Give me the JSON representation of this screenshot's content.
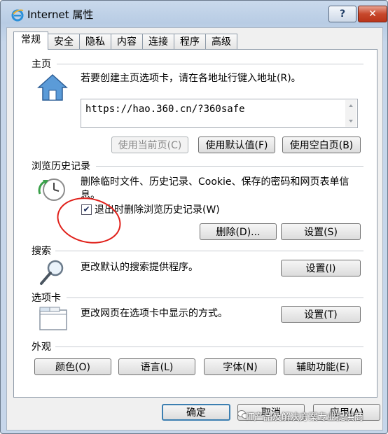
{
  "window": {
    "title": "Internet 属性",
    "help": "?",
    "close": "✕"
  },
  "tabs": [
    {
      "label": "常规"
    },
    {
      "label": "安全"
    },
    {
      "label": "隐私"
    },
    {
      "label": "内容"
    },
    {
      "label": "连接"
    },
    {
      "label": "程序"
    },
    {
      "label": "高级"
    }
  ],
  "homepage": {
    "title": "主页",
    "desc": "若要创建主页选项卡，请在各地址行键入地址(R)。",
    "url": "https://hao.360.cn/?360safe",
    "btn_current": "使用当前页(C)",
    "btn_default": "使用默认值(F)",
    "btn_blank": "使用空白页(B)"
  },
  "history": {
    "title": "浏览历史记录",
    "desc": "删除临时文件、历史记录、Cookie、保存的密码和网页表单信息。",
    "checkbox_label": "退出时删除浏览历史记录(W)",
    "checkbox_checked": true,
    "btn_delete": "删除(D)...",
    "btn_settings": "设置(S)"
  },
  "search": {
    "title": "搜索",
    "desc": "更改默认的搜索提供程序。",
    "btn_settings": "设置(I)"
  },
  "tabs_section": {
    "title": "选项卡",
    "desc": "更改网页在选项卡中显示的方式。",
    "btn_settings": "设置(T)"
  },
  "appearance": {
    "title": "外观",
    "btn_colors": "颜色(O)",
    "btn_languages": "语言(L)",
    "btn_fonts": "字体(N)",
    "btn_accessibility": "辅助功能(E)"
  },
  "footer": {
    "ok": "确定",
    "cancel": "取消",
    "apply": "应用(A)"
  },
  "watermark": "IT产品及解决方案专业提供商",
  "colors": {
    "accent": "#3c7fb1",
    "annotation": "#e0201a"
  }
}
